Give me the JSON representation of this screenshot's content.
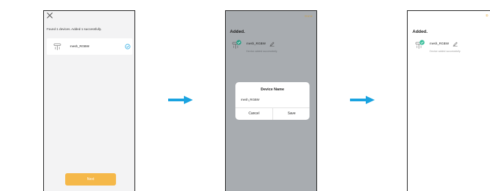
{
  "screen_found": {
    "close_icon": "close-icon",
    "status_text": "Found 1 devices. Added 1 successfully.",
    "device_name": "mesh_RGBW",
    "next_label": "Next"
  },
  "screen_rename": {
    "done_label": "Done",
    "title": "Added.",
    "device_name": "mesh_RGBW",
    "device_status": "Device added successfully",
    "dialog": {
      "title": "Device Name",
      "input_value": "mesh_RGBW",
      "cancel_label": "Cancel",
      "save_label": "Save"
    }
  },
  "screen_added": {
    "done_label": "D",
    "title": "Added.",
    "device_name": "mesh_RGBW",
    "device_status": "Device added successfully"
  },
  "colors": {
    "arrow": "#1aa3e0",
    "accent_orange": "#f5b849",
    "check_green": "#3cbf9c"
  }
}
